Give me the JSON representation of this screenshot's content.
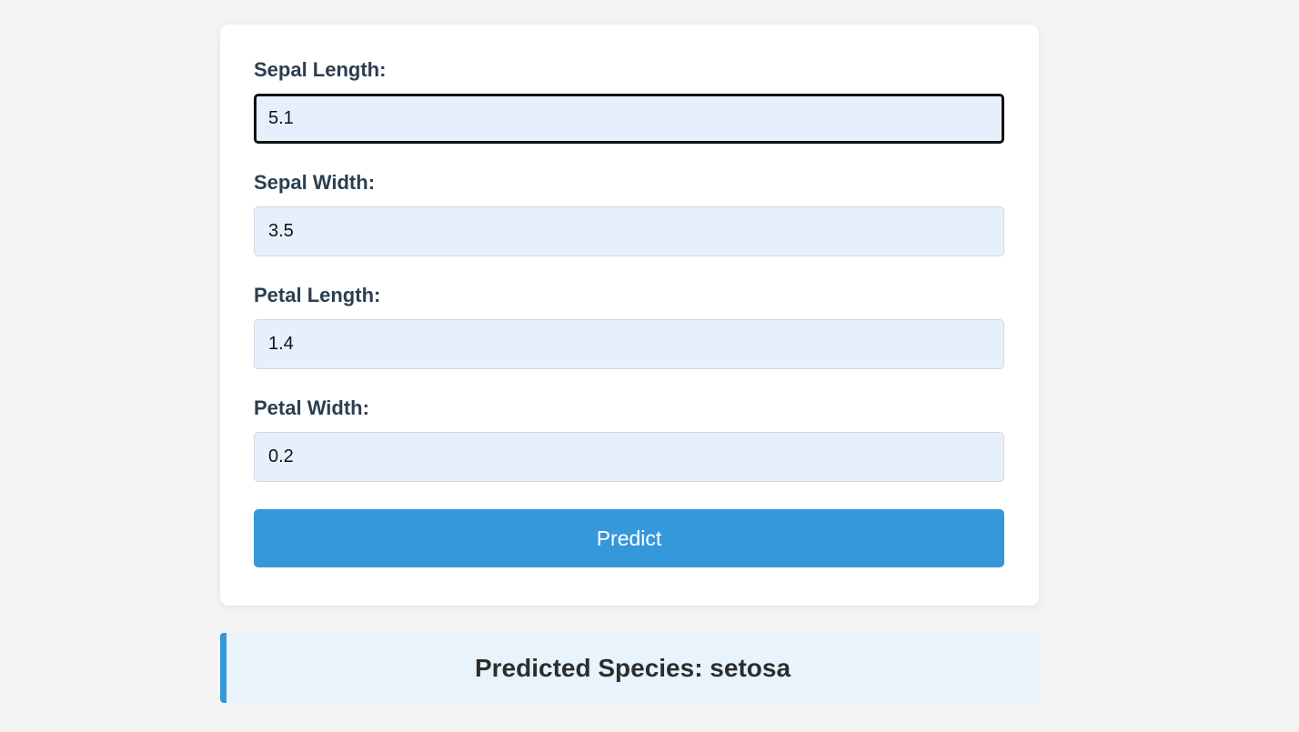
{
  "form": {
    "fields": [
      {
        "label": "Sepal Length:",
        "value": "5.1"
      },
      {
        "label": "Sepal Width:",
        "value": "3.5"
      },
      {
        "label": "Petal Length:",
        "value": "1.4"
      },
      {
        "label": "Petal Width:",
        "value": "0.2"
      }
    ],
    "submit_label": "Predict"
  },
  "result": {
    "text": "Predicted Species: setosa"
  },
  "colors": {
    "accent": "#3498db",
    "input_bg": "#e8effc",
    "result_bg": "#e8f3fc",
    "page_bg": "#f4f4f4"
  }
}
